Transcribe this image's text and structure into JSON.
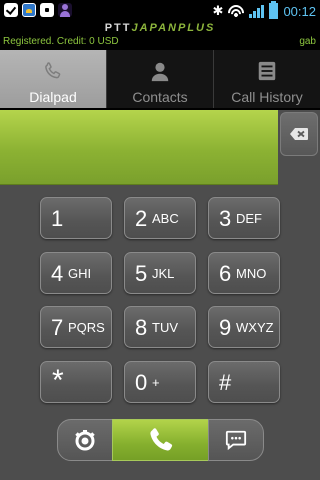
{
  "status_bar": {
    "clock": "00:12",
    "bluetooth_glyph": "✱",
    "notification_icons": [
      "check-icon",
      "photo-icon",
      "bag-icon",
      "person-icon"
    ],
    "battery_color": "#5ec3f2"
  },
  "header": {
    "brand_part1": "PTT",
    "brand_part2": "JAPANPLUS",
    "registration_status": "Registered. Credit: 0 USD",
    "username": "gab",
    "accent_color": "#8dc63f"
  },
  "tabs": [
    {
      "label": "Dialpad",
      "icon": "phone-icon",
      "active": true
    },
    {
      "label": "Contacts",
      "icon": "contact-icon",
      "active": false
    },
    {
      "label": "Call History",
      "icon": "history-icon",
      "active": false
    }
  ],
  "dialer": {
    "number": "",
    "backspace_icon": "backspace-icon",
    "keys": [
      {
        "digit": "1",
        "letters": ""
      },
      {
        "digit": "2",
        "letters": "ABC"
      },
      {
        "digit": "3",
        "letters": "DEF"
      },
      {
        "digit": "4",
        "letters": "GHI"
      },
      {
        "digit": "5",
        "letters": "JKL"
      },
      {
        "digit": "6",
        "letters": "MNO"
      },
      {
        "digit": "7",
        "letters": "PQRS"
      },
      {
        "digit": "8",
        "letters": "TUV"
      },
      {
        "digit": "9",
        "letters": "WXYZ"
      },
      {
        "digit": "*",
        "letters": ""
      },
      {
        "digit": "0",
        "letters": "+"
      },
      {
        "digit": "#",
        "letters": ""
      }
    ]
  },
  "actions": {
    "left_icon": "voicemail-icon",
    "center_icon": "call-icon",
    "right_icon": "sms-icon",
    "call_color": "#8cb233"
  }
}
